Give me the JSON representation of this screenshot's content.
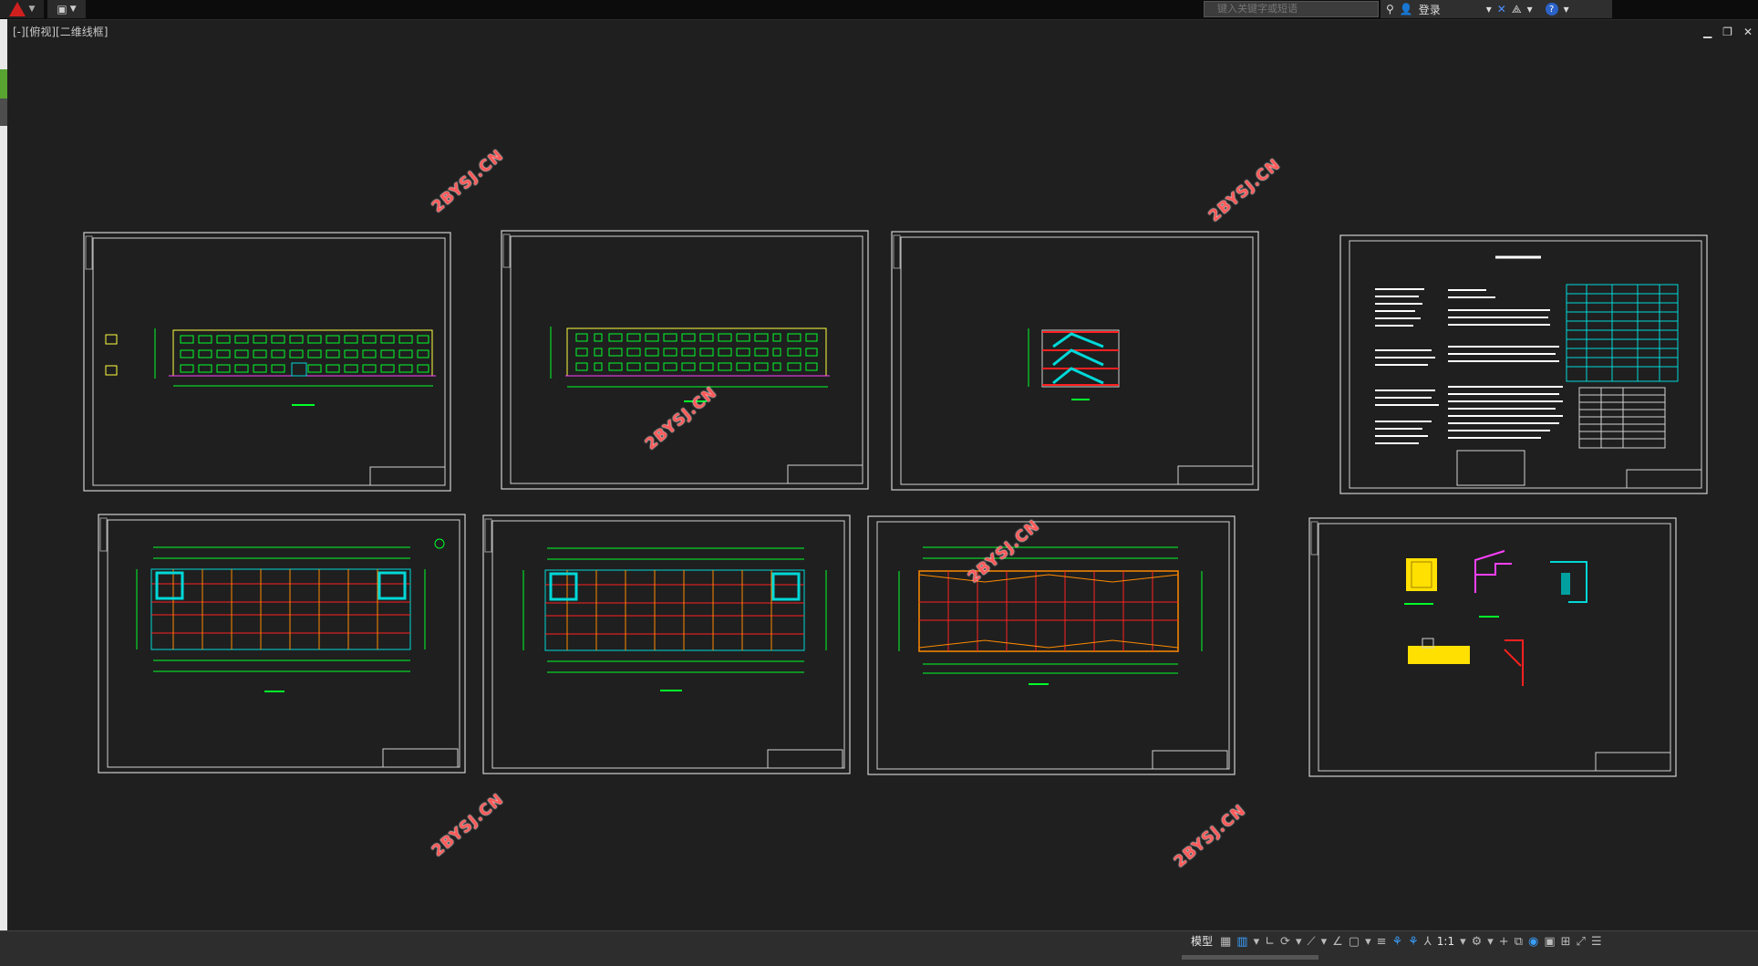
{
  "titlebar": {
    "search_placeholder": "键入关键字或短语",
    "login_label": "登录",
    "help_label": "?"
  },
  "viewport": {
    "label": "[-][俯视][二维线框]"
  },
  "watermark": {
    "text": "2BYSJ.CN"
  },
  "statusbar": {
    "model_label": "模型",
    "scale_label": "1:1"
  },
  "colors": {
    "background": "#1f1f1f",
    "grid_green": "#00ff2a",
    "structure_red": "#ff2020",
    "column_orange": "#ff8a00",
    "stair_cyan": "#00d8d8",
    "elevation_yellow": "#ffff40",
    "watermark_red": "#ff5a5a"
  },
  "sheets": [
    {
      "name": "north-elevation-sheet"
    },
    {
      "name": "south-elevation-sheet"
    },
    {
      "name": "section-sheet"
    },
    {
      "name": "design-notes-sheet"
    },
    {
      "name": "ground-floor-plan-sheet"
    },
    {
      "name": "standard-floor-plan-sheet"
    },
    {
      "name": "roof-plan-sheet"
    },
    {
      "name": "details-sheet"
    }
  ]
}
